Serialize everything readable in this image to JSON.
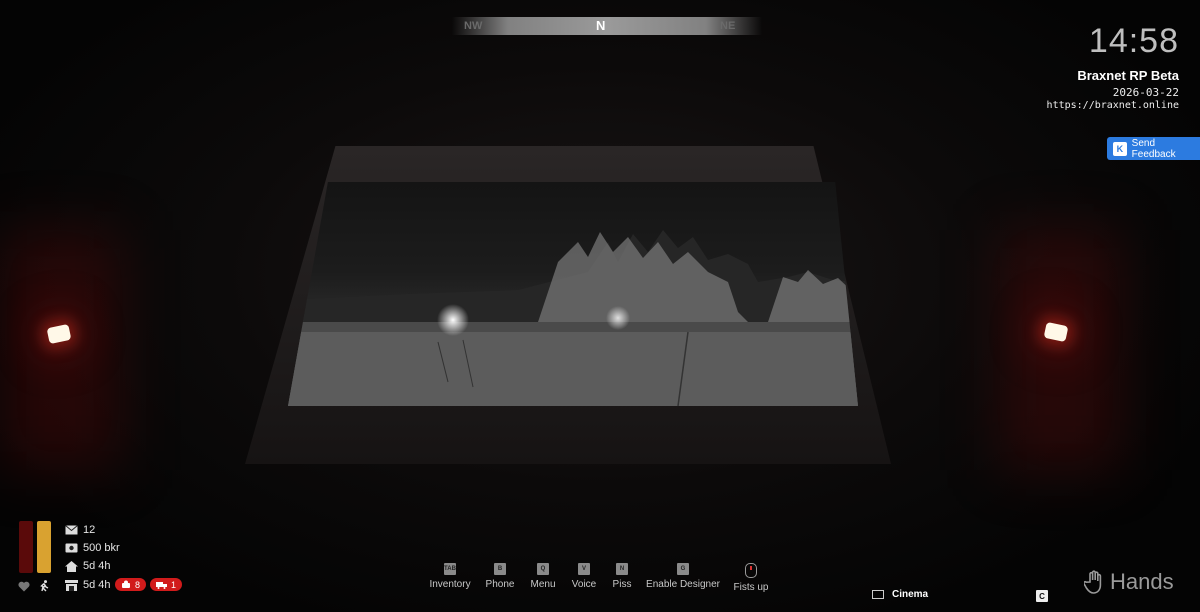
{
  "compass": {
    "left": "NW",
    "center": "N",
    "right": "NE"
  },
  "clock": "14:58",
  "server": {
    "name": "Braxnet RP Beta",
    "date": "2026-03-22",
    "url": "https://braxnet.online"
  },
  "feedback": {
    "key": "K",
    "label": "Send Feedback"
  },
  "hud": {
    "health_level": 1.0,
    "stamina_level": 1.0,
    "mail_count": "12",
    "money": "500 bkr",
    "home_time": "5d 4h",
    "storage_time": "5d 4h",
    "wanted_count": "8",
    "vehicle_count": "1"
  },
  "hotbar": [
    {
      "key": "TAB",
      "label": "Inventory"
    },
    {
      "key": "B",
      "label": "Phone"
    },
    {
      "key": "Q",
      "label": "Menu"
    },
    {
      "key": "V",
      "label": "Voice"
    },
    {
      "key": "N",
      "label": "Piss"
    },
    {
      "key": "G",
      "label": "Enable Designer"
    },
    {
      "key": "",
      "label": "Fists up"
    }
  ],
  "location": {
    "label": "Cinema",
    "key": "C"
  },
  "mode": {
    "label": "Hands"
  },
  "colors": {
    "accent_blue": "#2c7be0",
    "stamina": "#d9a230",
    "health": "#5a0a0a",
    "badge_red": "#d11b1b"
  }
}
